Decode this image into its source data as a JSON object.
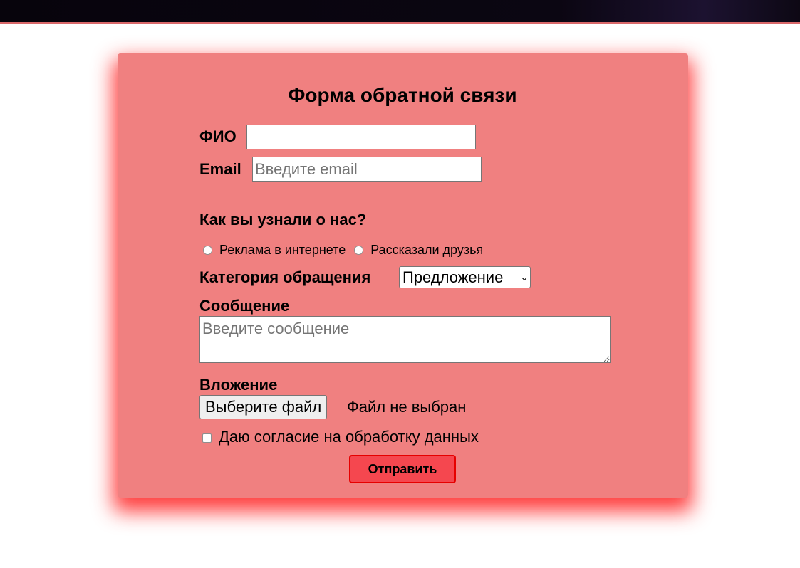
{
  "colors": {
    "card_background": "#f08080",
    "card_shadow": "#ff1e1e",
    "submit_background": "#f5474f",
    "submit_border": "#e60000"
  },
  "form": {
    "title": "Форма обратной связи",
    "fio": {
      "label": "ФИО",
      "value": "",
      "placeholder": ""
    },
    "email": {
      "label": "Email",
      "value": "",
      "placeholder": "Введите email"
    },
    "source": {
      "question": "Как вы узнали о нас?",
      "options": [
        "Реклама в интернете",
        "Рассказали друзья"
      ],
      "selected": null
    },
    "category": {
      "label": "Категория обращения",
      "selected": "Предложение"
    },
    "message": {
      "label": "Сообщение",
      "value": "",
      "placeholder": "Введите сообщение"
    },
    "attachment": {
      "label": "Вложение",
      "button_label": "Выберите файл",
      "status": "Файл не выбран"
    },
    "consent": {
      "label": "Даю согласие на обработку данных",
      "checked": false
    },
    "submit_label": "Отправить"
  }
}
